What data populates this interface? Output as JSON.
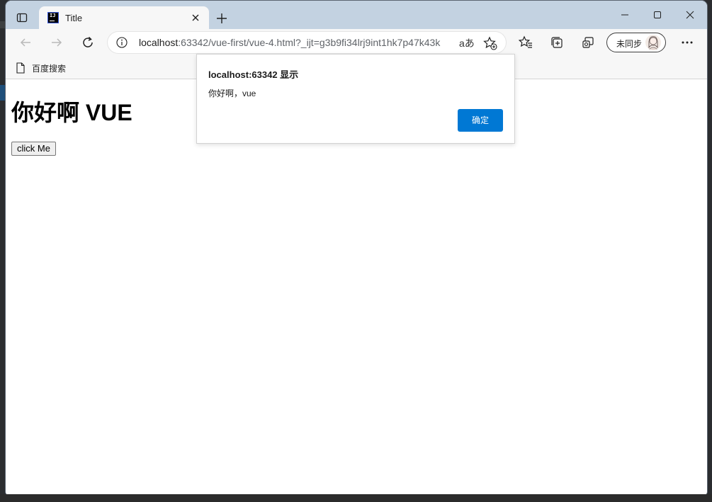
{
  "tab": {
    "title": "Title",
    "favicon_text": "IJ"
  },
  "address": {
    "host": "localhost",
    "rest": ":63342/vue-first/vue-4.html?_ijt=g3b9fi34lrj9int1hk7p47k43k",
    "read_aloud": "aあ"
  },
  "sync": {
    "label": "未同步"
  },
  "bookmarks": [
    {
      "label": "百度搜索"
    }
  ],
  "page": {
    "heading": "你好啊 VUE",
    "button_label": "click Me"
  },
  "dialog": {
    "title": "localhost:63342 显示",
    "message": "你好啊，vue",
    "ok_label": "确定"
  },
  "colors": {
    "titlebar": "#c3d2e1",
    "toolbar": "#f7f7f7",
    "accent": "#0078d4"
  }
}
